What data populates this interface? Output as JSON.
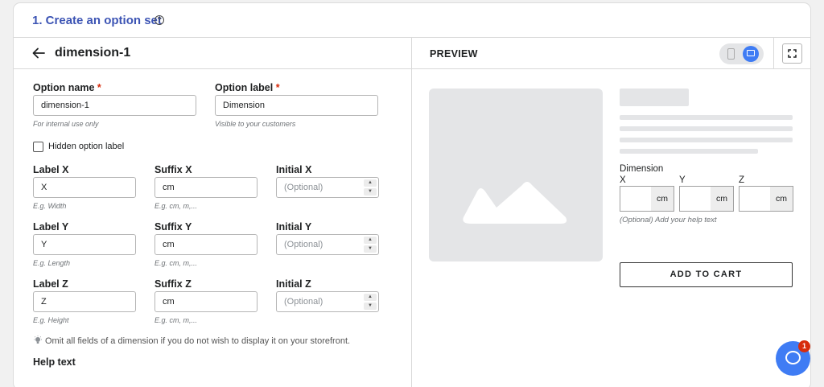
{
  "header": {
    "title": "1. Create an option set",
    "help_glyph": "?"
  },
  "option": {
    "back_icon": "arrow-left-icon",
    "title": "dimension-1"
  },
  "form": {
    "option_name": {
      "label": "Option name",
      "required": "*",
      "value": "dimension-1",
      "hint": "For internal use only"
    },
    "option_label": {
      "label": "Option label",
      "required": "*",
      "value": "Dimension",
      "hint": "Visible to your customers"
    },
    "hidden_option_label": {
      "label": "Hidden option label",
      "checked": false
    },
    "rows": [
      {
        "label": "Label X",
        "value": "X",
        "hint": "E.g. Width",
        "suffix_label": "Suffix X",
        "suffix_value": "cm",
        "suffix_hint": "E.g. cm, m,...",
        "initial_label": "Initial X",
        "initial_placeholder": "(Optional)"
      },
      {
        "label": "Label Y",
        "value": "Y",
        "hint": "E.g. Length",
        "suffix_label": "Suffix Y",
        "suffix_value": "cm",
        "suffix_hint": "E.g. cm, m,...",
        "initial_label": "Initial Y",
        "initial_placeholder": "(Optional)"
      },
      {
        "label": "Label Z",
        "value": "Z",
        "hint": "E.g. Height",
        "suffix_label": "Suffix Z",
        "suffix_value": "cm",
        "suffix_hint": "E.g. cm, m,...",
        "initial_label": "Initial Z",
        "initial_placeholder": "(Optional)"
      }
    ],
    "tip": "Omit all fields of a dimension if you do not wish to display it on your storefront.",
    "help_text_label": "Help text",
    "spin_up": "▲",
    "spin_down": "▼"
  },
  "preview": {
    "title": "PREVIEW",
    "device_toggle": {
      "selected": "desktop",
      "icons": [
        "mobile-icon",
        "desktop-icon"
      ]
    },
    "fullscreen_icon": "fullscreen-icon",
    "image_icon": "mountain-image-icon",
    "option_label": "Dimension",
    "fields": [
      {
        "label": "X",
        "suffix": "cm"
      },
      {
        "label": "Y",
        "suffix": "cm"
      },
      {
        "label": "Z",
        "suffix": "cm"
      }
    ],
    "help_text": "(Optional) Add your help text",
    "add_to_cart": "ADD TO CART"
  },
  "chat": {
    "icon": "chat-bubble-icon",
    "badge": "1"
  },
  "colors": {
    "accent": "#3f7cf4",
    "title": "#3c54b4",
    "required": "#d72c0d",
    "skeleton": "#e4e5e7"
  }
}
